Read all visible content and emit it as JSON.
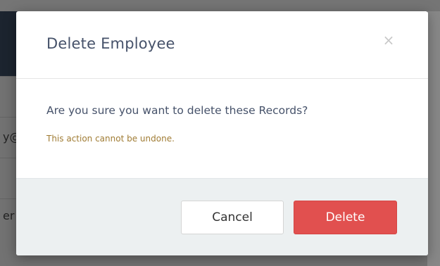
{
  "modal": {
    "title": "Delete Employee",
    "close_symbol": "×",
    "close_icon": "close-icon",
    "message": "Are you sure you want to delete these Records?",
    "warning": "This action cannot be undone.",
    "buttons": {
      "cancel_label": "Cancel",
      "delete_label": "Delete"
    }
  },
  "background": {
    "row_fragments": [
      "y@",
      "er"
    ]
  },
  "colors": {
    "header_bg": "#232d3a",
    "title_text": "#46526a",
    "warning_text": "#a07c34",
    "footer_bg": "#ecf0f1",
    "delete_button": "#e1504f"
  }
}
